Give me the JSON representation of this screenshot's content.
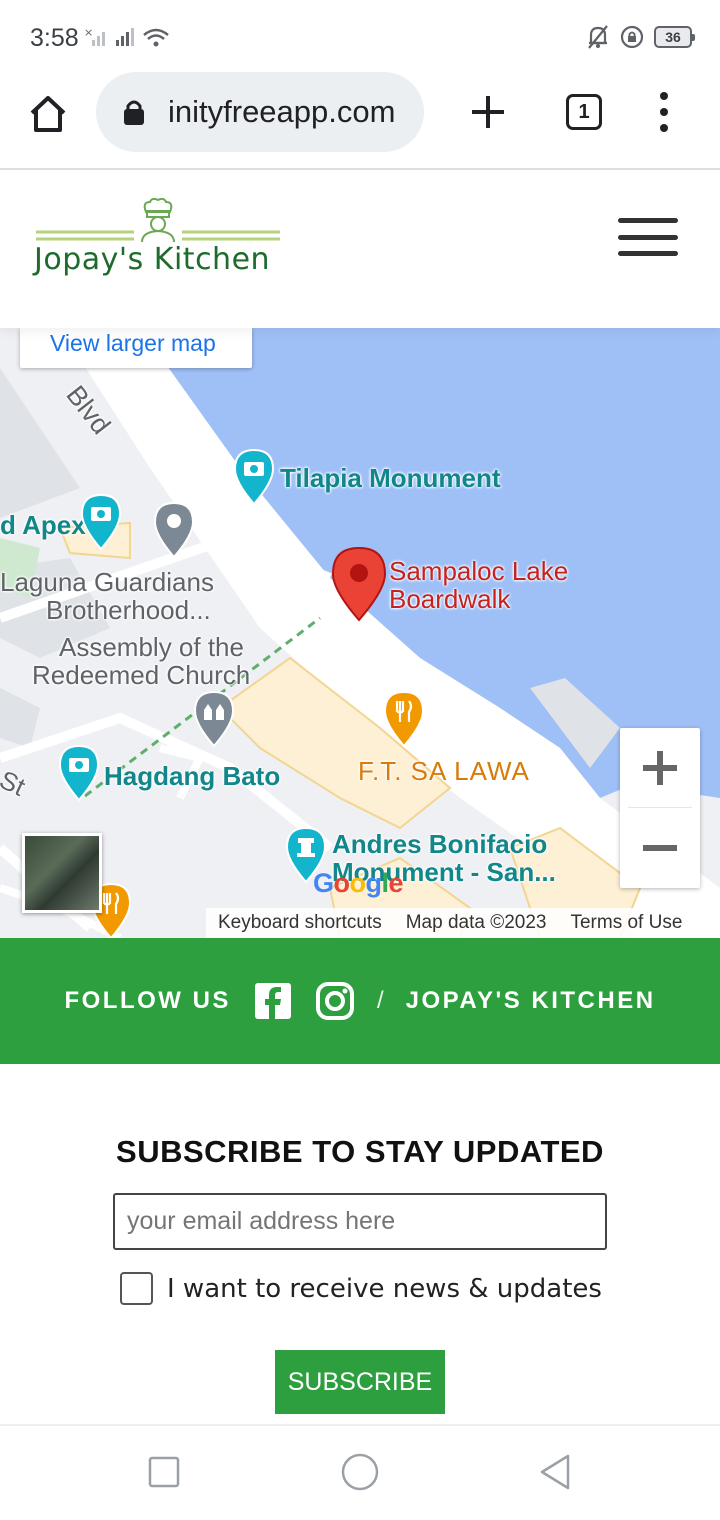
{
  "status_bar": {
    "time": "3:58",
    "battery": "36"
  },
  "browser": {
    "url": "inityfreeapp.com",
    "tab_count": "1"
  },
  "site": {
    "brand": "Jopay's Kitchen"
  },
  "map": {
    "view_larger": "View larger map",
    "labels": {
      "blvd": "Blvd",
      "apex": "d Apex",
      "tilapia": "Tilapia Monument",
      "sampaloc_1": "Sampaloc Lake",
      "sampaloc_2": "Boardwalk",
      "laguna_1": "Laguna Guardians",
      "laguna_2": "Brotherhood...",
      "assembly_1": "Assembly of the",
      "assembly_2": "Redeemed Church",
      "hagdang": "Hagdang Bato",
      "ft_lawa": "F.T. SA LAWA",
      "andres_1": "Andres Bonifacio",
      "andres_2": "Monument -  San...",
      "st": "St"
    },
    "google": "Google",
    "attribution": {
      "shortcuts": "Keyboard shortcuts",
      "map_data": "Map data ©2023",
      "terms": "Terms of Use"
    },
    "colors": {
      "water": "#9fc0f7",
      "teal_pin": "#12b5cb",
      "red_pin": "#ea4335",
      "orange_pin": "#f29900"
    }
  },
  "follow": {
    "label": "FOLLOW US",
    "separator": "/",
    "brand": "JOPAY'S KITCHEN",
    "color": "#2d9f3e"
  },
  "subscribe": {
    "title": "SUBSCRIBE TO STAY UPDATED",
    "email_placeholder": "your email address here",
    "checkbox_label": "I want to receive news & updates",
    "button": "SUBSCRIBE"
  }
}
